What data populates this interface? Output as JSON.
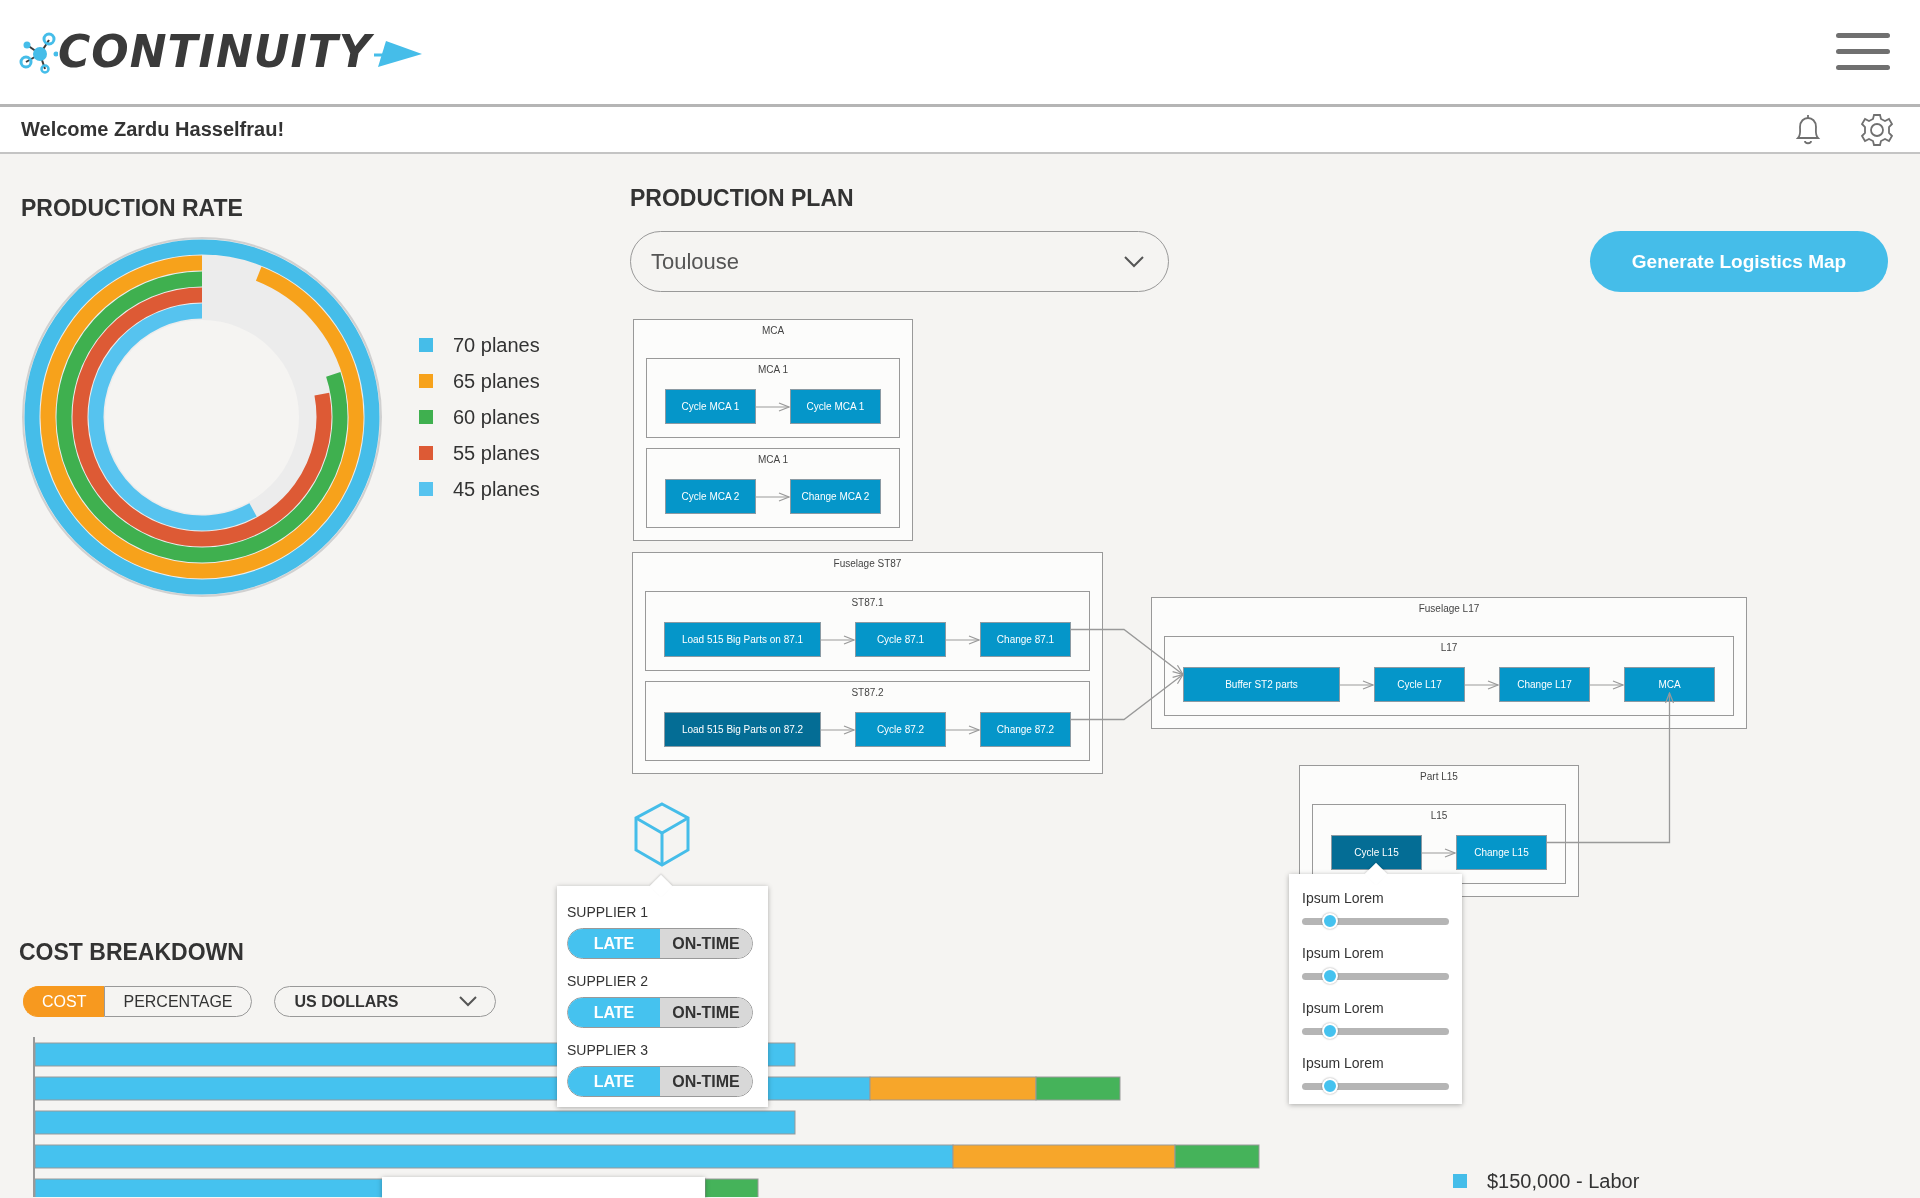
{
  "header": {
    "logo_text": "CONTINUITY"
  },
  "welcome": "Welcome Zardu Hasselfrau!",
  "production_rate": {
    "title": "PRODUCTION RATE",
    "legend": [
      {
        "label": "70 planes",
        "color": "#45bde9"
      },
      {
        "label": "65 planes",
        "color": "#f7a21b"
      },
      {
        "label": "60 planes",
        "color": "#3fb04f"
      },
      {
        "label": "55 planes",
        "color": "#dd5a35"
      },
      {
        "label": "45 planes",
        "color": "#56c3ef"
      }
    ]
  },
  "production_plan": {
    "title": "PRODUCTION PLAN",
    "site_select": {
      "value": "Toulouse"
    },
    "generate_button": "Generate Logistics Map",
    "groups": [
      {
        "title": "MCA",
        "subgroups": [
          {
            "title": "MCA 1",
            "nodes": [
              {
                "label": "Cycle MCA 1",
                "selected": false
              },
              {
                "label": "Cycle MCA 1",
                "selected": false
              }
            ]
          },
          {
            "title": "MCA 1",
            "nodes": [
              {
                "label": "Cycle MCA 2",
                "selected": false
              },
              {
                "label": "Change MCA 2",
                "selected": false
              }
            ]
          }
        ]
      },
      {
        "title": "Fuselage ST87",
        "subgroups": [
          {
            "title": "ST87.1",
            "nodes": [
              {
                "label": "Load 515 Big Parts on 87.1",
                "selected": false
              },
              {
                "label": "Cycle 87.1",
                "selected": false
              },
              {
                "label": "Change 87.1",
                "selected": false
              }
            ]
          },
          {
            "title": "ST87.2",
            "nodes": [
              {
                "label": "Load 515 Big Parts on 87.2",
                "selected": true
              },
              {
                "label": "Cycle 87.2",
                "selected": false
              },
              {
                "label": "Change 87.2",
                "selected": false
              }
            ]
          }
        ]
      },
      {
        "title": "Fuselage L17",
        "subgroups": [
          {
            "title": "L17",
            "nodes": [
              {
                "label": "Buffer ST2 parts",
                "selected": false
              },
              {
                "label": "Cycle L17",
                "selected": false
              },
              {
                "label": "Change L17",
                "selected": false
              },
              {
                "label": "MCA",
                "selected": false
              }
            ]
          }
        ]
      },
      {
        "title": "Part L15",
        "subgroups": [
          {
            "title": "L15",
            "nodes": [
              {
                "label": "Cycle L15",
                "selected": true
              },
              {
                "label": "Change L15",
                "selected": false
              }
            ]
          }
        ]
      }
    ],
    "supplier_popup": {
      "suppliers": [
        {
          "label": "SUPPLIER 1",
          "options": [
            {
              "label": "LATE",
              "selected": true
            },
            {
              "label": "ON-TIME",
              "selected": false
            }
          ]
        },
        {
          "label": "SUPPLIER 2",
          "options": [
            {
              "label": "LATE",
              "selected": true
            },
            {
              "label": "ON-TIME",
              "selected": false
            }
          ]
        },
        {
          "label": "SUPPLIER 3",
          "options": [
            {
              "label": "LATE",
              "selected": true
            },
            {
              "label": "ON-TIME",
              "selected": false
            }
          ]
        }
      ]
    },
    "node_popup": {
      "sliders": [
        {
          "label": "Ipsum Lorem",
          "level": 0.19
        },
        {
          "label": "Ipsum Lorem",
          "level": 0.19
        },
        {
          "label": "Ipsum Lorem",
          "level": 0.19
        },
        {
          "label": "Ipsum Lorem",
          "level": 0.19
        }
      ]
    }
  },
  "cost_breakdown": {
    "title": "COST BREAKDOWN",
    "tabs": [
      {
        "label": "COST",
        "selected": true
      },
      {
        "label": "PERCENTAGE",
        "selected": false
      }
    ],
    "currency_select": {
      "value": "US DOLLARS"
    },
    "legend": [
      {
        "label": "$150,000 - Labor",
        "color": "#45bde9"
      }
    ]
  }
}
